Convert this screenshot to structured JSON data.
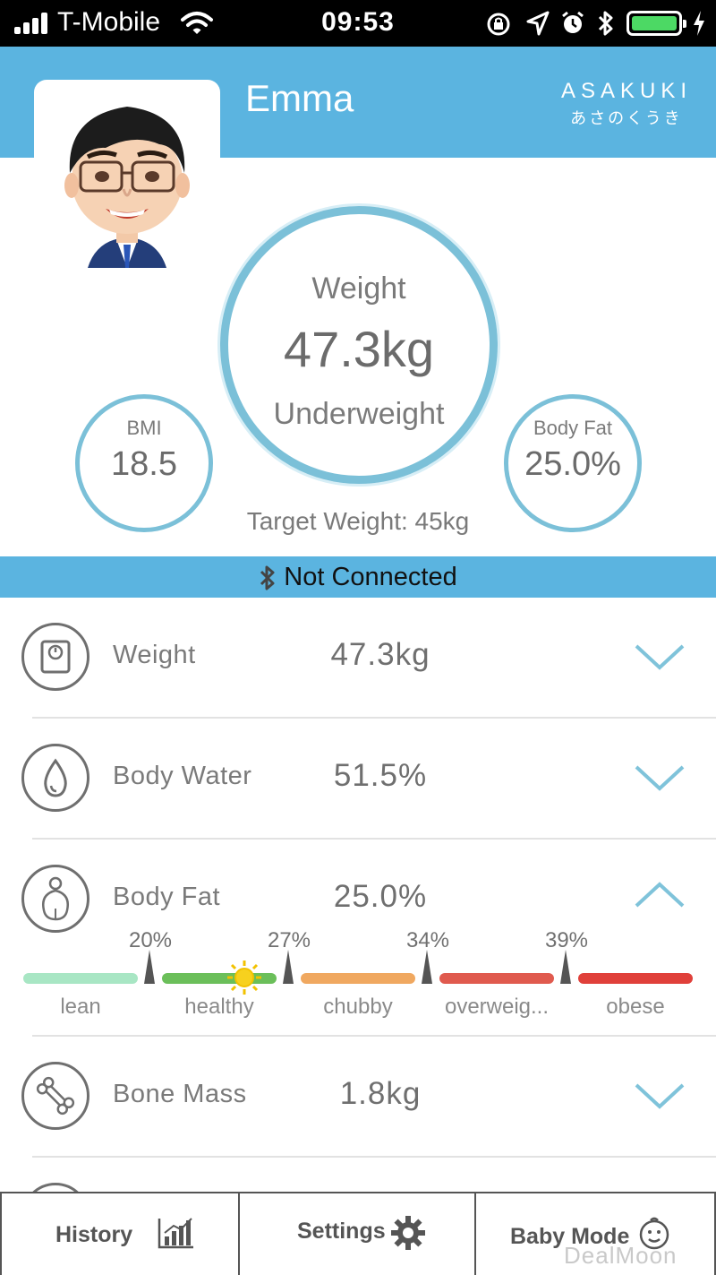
{
  "status_bar": {
    "carrier": "T-Mobile",
    "time": "09:53"
  },
  "header": {
    "user_name": "Emma",
    "brand_name": "ASAKUKI",
    "brand_subtitle": "あさのくうき",
    "accent_color": "#5bb4e0"
  },
  "summary": {
    "weight_label": "Weight",
    "weight_value": "47.3kg",
    "weight_status": "Underweight",
    "bmi_label": "BMI",
    "bmi_value": "18.5",
    "body_fat_label": "Body Fat",
    "body_fat_value": "25.0%",
    "target_weight": "Target Weight: 45kg"
  },
  "connection": {
    "status": "Not Connected"
  },
  "metrics": [
    {
      "name": "Weight",
      "value": "47.3kg",
      "icon": "scale-icon",
      "expanded": false
    },
    {
      "name": "Body Water",
      "value": "51.5%",
      "icon": "water-drop-icon",
      "expanded": false
    },
    {
      "name": "Body Fat",
      "value": "25.0%",
      "icon": "body-icon",
      "expanded": true
    },
    {
      "name": "Bone Mass",
      "value": "1.8kg",
      "icon": "bone-icon",
      "expanded": false
    }
  ],
  "body_fat_scale": {
    "thresholds": [
      "20%",
      "27%",
      "34%",
      "39%"
    ],
    "segments": [
      {
        "label": "lean",
        "color": "#a8e6c4"
      },
      {
        "label": "healthy",
        "color": "#6bbf5a"
      },
      {
        "label": "chubby",
        "color": "#f0a860"
      },
      {
        "label": "overweig...",
        "color": "#e05a4e"
      },
      {
        "label": "obese",
        "color": "#e0403a"
      }
    ],
    "current_value": 25.0
  },
  "tabs": [
    {
      "label": "History",
      "icon": "bar-chart-icon"
    },
    {
      "label": "Settings",
      "icon": "gear-icon"
    },
    {
      "label": "Baby Mode",
      "icon": "baby-face-icon"
    }
  ],
  "watermark": "DealMoon"
}
